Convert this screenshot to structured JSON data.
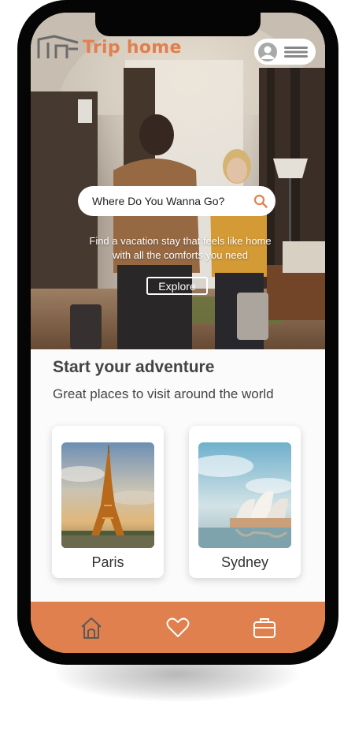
{
  "app": {
    "name": "Trip home",
    "accent_color": "#e0804f",
    "logo_icon": "house-outline-icon"
  },
  "header": {
    "profile_icon": "user-avatar-icon",
    "menu_icon": "hamburger-menu-icon"
  },
  "hero": {
    "search_placeholder": "Where Do You Wanna Go?",
    "search_icon": "search-icon",
    "tagline_line1": "Find a vacation stay that feels like home",
    "tagline_line2": "with all the comforts you need",
    "explore_label": "Explore"
  },
  "section": {
    "title": "Start your adventure",
    "subtitle": "Great places to visit around the world"
  },
  "destinations": [
    {
      "name": "Paris",
      "image": "eiffel-tower-photo"
    },
    {
      "name": "Sydney",
      "image": "sydney-opera-house-photo"
    }
  ],
  "bottom_nav": [
    {
      "id": "home",
      "icon": "home-icon"
    },
    {
      "id": "favorites",
      "icon": "heart-icon"
    },
    {
      "id": "trips",
      "icon": "briefcase-icon"
    }
  ]
}
